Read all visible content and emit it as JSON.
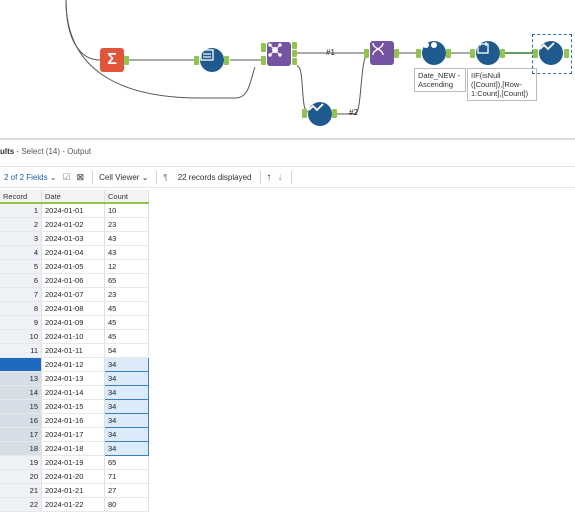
{
  "canvas": {
    "wire_labels": [
      "#1",
      "#2"
    ],
    "annotations": {
      "sort": "Date_NEW -\nAscending",
      "formula": "IIF(isNull\n([Count]),[Row-\n1:Count],[Count])"
    },
    "tool_colors": {
      "summarize": "#e1553a",
      "formula_input": "#1e5a8e",
      "join": "#7453a3",
      "select": "#1e5a8e",
      "multirow": "#7453a3",
      "sort": "#1e5a8e",
      "formula": "#1e5a8e",
      "connector": "#8fc64a"
    },
    "icons": [
      "summarize-icon",
      "formula-input-icon",
      "join-icon",
      "select-check-icon",
      "multi-row-icon",
      "sort-icon",
      "formula-icon"
    ]
  },
  "results": {
    "title": "ults",
    "subtitle": " - Select (14) - Output"
  },
  "toolbar": {
    "fields_label": "2 of 2 Fields",
    "viewer_label": "Cell Viewer",
    "records_label": "22 records displayed"
  },
  "table": {
    "columns": [
      "Record",
      "Date",
      "Count"
    ],
    "rows": [
      [
        "1",
        "2024-01-01",
        "10"
      ],
      [
        "2",
        "2024-01-02",
        "23"
      ],
      [
        "3",
        "2024-01-03",
        "43"
      ],
      [
        "4",
        "2024-01-04",
        "43"
      ],
      [
        "5",
        "2024-01-05",
        "12"
      ],
      [
        "6",
        "2024-01-06",
        "65"
      ],
      [
        "7",
        "2024-01-07",
        "23"
      ],
      [
        "8",
        "2024-01-08",
        "45"
      ],
      [
        "9",
        "2024-01-09",
        "45"
      ],
      [
        "10",
        "2024-01-10",
        "45"
      ],
      [
        "11",
        "2024-01-11",
        "54"
      ],
      [
        "12",
        "2024-01-12",
        "34"
      ],
      [
        "13",
        "2024-01-13",
        "34"
      ],
      [
        "14",
        "2024-01-14",
        "34"
      ],
      [
        "15",
        "2024-01-15",
        "34"
      ],
      [
        "16",
        "2024-01-16",
        "34"
      ],
      [
        "17",
        "2024-01-17",
        "34"
      ],
      [
        "18",
        "2024-01-18",
        "34"
      ],
      [
        "19",
        "2024-01-19",
        "65"
      ],
      [
        "20",
        "2024-01-20",
        "71"
      ],
      [
        "21",
        "2024-01-21",
        "27"
      ],
      [
        "22",
        "2024-01-22",
        "80"
      ]
    ],
    "selected_rows": [
      12,
      13,
      14,
      15,
      16,
      17,
      18
    ]
  }
}
